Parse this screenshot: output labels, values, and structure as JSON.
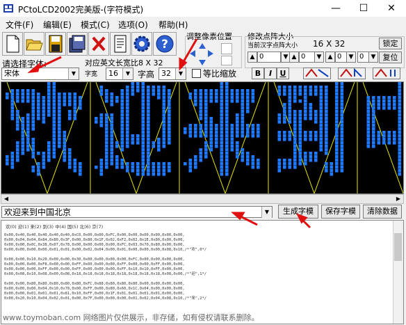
{
  "window": {
    "title": "PCtoLCD2002完美版-(字符模式)",
    "minimize": "—",
    "maximize": "☐",
    "close": "✕"
  },
  "menu": [
    "文件(F)",
    "编辑(E)",
    "模式(C)",
    "选项(O)",
    "帮助(H)"
  ],
  "toolbar_icons": [
    "new-file-icon",
    "open-folder-icon",
    "save-icon",
    "save-as-icon",
    "clear-icon",
    "settings-document-icon",
    "options-gear-icon",
    "help-icon"
  ],
  "pixel_adjust": {
    "label": "调整像素位置"
  },
  "dot_size": {
    "label": "修改点阵大小",
    "sublabel": "当前汉字点阵大小",
    "value": "16 X 32",
    "lock_btn": "锁定",
    "reset_btn": "复位",
    "spinners": [
      "0",
      "0",
      "0",
      "0"
    ]
  },
  "font_select": {
    "label": "请选择字体:",
    "value": "宋体"
  },
  "english_width": {
    "label": "对应英文长宽比8 X 32"
  },
  "size_row": {
    "char_width_label": "字宽",
    "char_width_value": "16",
    "char_height_label": "字高",
    "char_height_value": "32",
    "ratio_label": "等比缩放",
    "bold": "B",
    "italic": "I",
    "underline": "U"
  },
  "input": {
    "value": "欢迎来到中国北京"
  },
  "buttons": {
    "generate": "生成字模",
    "save": "保存字模",
    "clear": "清除数据"
  },
  "output": {
    "header": "欢(0) 迎(1) 来(2) 到(3) 中(4) 国(5) 北(6) 京(7)",
    "lines": [
      "0x00,0x40,0x40,0x40,0x40,0x40,0xC0,0x00,0x00,0xFC,0x00,0x00,0x00,0x00,0x00,0x00,",
      "0x00,0x04,0x04,0x84,0x80,0x3F,0x00,0x80,0x1F,0x02,0xF2,0x02,0x1E,0x00,0x00,0x00,",
      "0x00,0x00,0x0C,0x38,0x07,0x78,0x00,0x00,0x00,0x00,0xFC,0x03,0x70,0x80,0x00,0x00,",
      "0x00,0x00,0x00,0x00,0x01,0x01,0x00,0x02,0x04,0x00,0x01,0x00,0x00,0x00,0x08,0x10,/*\"欢\",0*/",
      "",
      "0x00,0x00,0x10,0x20,0x00,0x00,0x30,0x00,0x00,0x00,0x00,0xFC,0x00,0x00,0x00,0x00,",
      "0x00,0x00,0x00,0xF8,0x00,0x00,0xFF,0x00,0x00,0x00,0xFF,0x00,0x00,0xFF,0x00,0x00,",
      "0x00,0x00,0x00,0xFF,0x00,0x00,0xFF,0x00,0x00,0x00,0xFF,0x10,0x10,0xFF,0x00,0x00,",
      "0x00,0x08,0x10,0x08,0x00,0x08,0x18,0x18,0x18,0x18,0x18,0x18,0x18,0x18,0x08,0x00,/*\"迎\",1*/",
      "",
      "0x00,0x00,0x80,0x80,0x80,0x80,0x80,0xFC,0x88,0x80,0x80,0x80,0x00,0x00,0x00,0x00,",
      "0x00,0x00,0x00,0x04,0x10,0x78,0x00,0xFF,0x00,0x80,0x60,0x1C,0x04,0x00,0x00,0x00,",
      "0x00,0x00,0x01,0x01,0x01,0x81,0x10,0xFF,0x00,0x1F,0x01,0x01,0x01,0x01,0x00,0x00,",
      "0x00,0x20,0x10,0x04,0x02,0x01,0x00,0x7F,0x00,0x00,0x00,0x01,0x02,0x04,0x08,0x10,/*\"来\",2*/"
    ]
  },
  "watermark": "www.toymoban.com 网络图片仅供展示，非存储，如有侵权请联系删除。",
  "colors": {
    "pixel": "#1e7bff",
    "guide": "#e6e600",
    "canvas_bg": "#000000",
    "arrow": "#e01010"
  }
}
